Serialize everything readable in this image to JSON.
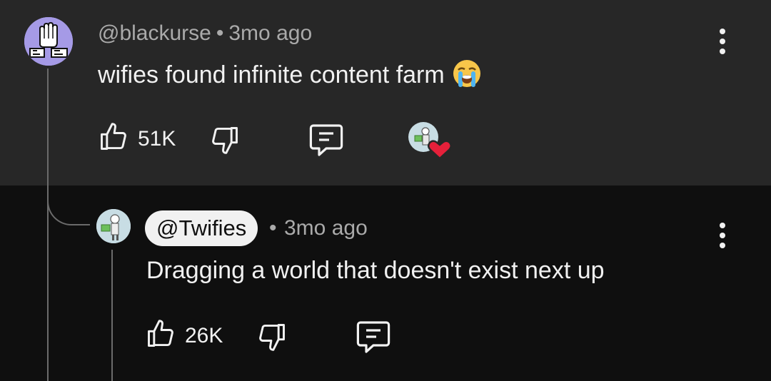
{
  "top_comment": {
    "author": "@blackurse",
    "separator": "•",
    "age": "3mo ago",
    "text": "wifies found infinite content farm",
    "emoji": "loudly-crying-face",
    "like_count": "51K",
    "icons": [
      "thumbs-up-icon",
      "thumbs-down-icon",
      "reply-icon",
      "hearted-by-creator-icon",
      "more-vert-icon"
    ]
  },
  "reply": {
    "author": "@Twifies",
    "separator": "•",
    "age": "3mo ago",
    "text": "Dragging a world that doesn't exist next up",
    "like_count": "26K",
    "icons": [
      "thumbs-up-icon",
      "thumbs-down-icon",
      "reply-icon",
      "more-vert-icon"
    ]
  },
  "colors": {
    "top_background": "#272727",
    "reply_background": "#0f0f0f",
    "secondary_text": "#aaaaaa",
    "heart": "#e5203a"
  }
}
